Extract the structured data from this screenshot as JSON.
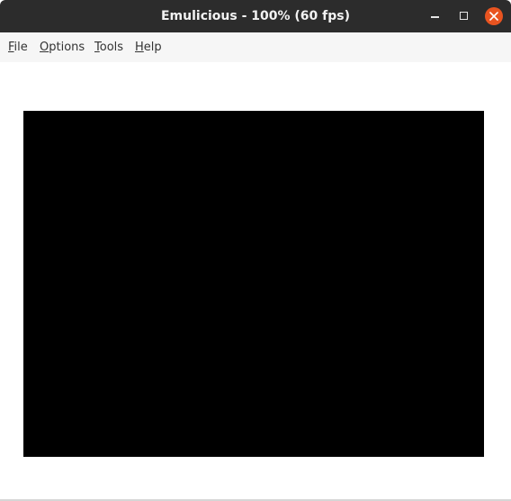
{
  "window": {
    "title": "Emulicious - 100% (60 fps)"
  },
  "menubar": {
    "items": [
      {
        "mnemonic": "F",
        "rest": "ile"
      },
      {
        "mnemonic": "O",
        "rest": "ptions"
      },
      {
        "mnemonic": "T",
        "rest": "ools"
      },
      {
        "mnemonic": "H",
        "rest": "elp"
      }
    ]
  },
  "icons": {
    "minimize": "minimize-icon",
    "maximize": "maximize-icon",
    "close": "close-icon"
  },
  "colors": {
    "titlebar": "#2c2c2c",
    "close_button": "#e95420",
    "menubar": "#f6f6f6",
    "screen": "#000000"
  }
}
